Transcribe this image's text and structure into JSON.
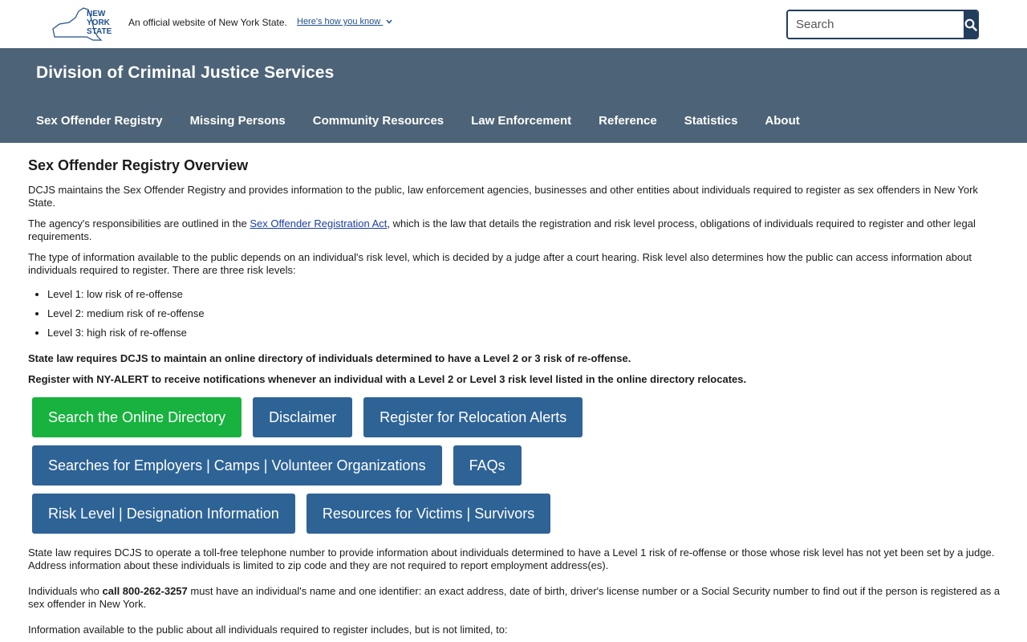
{
  "topbar": {
    "logo_text": [
      "NEW",
      "YORK",
      "STATE"
    ],
    "official_text": "An official website of New York State.",
    "how_know": "Here's how you know",
    "search_placeholder": "Search"
  },
  "header": {
    "agency_title": "Division of Criminal Justice Services",
    "nav": [
      {
        "label": "Sex Offender Registry"
      },
      {
        "label": "Missing Persons"
      },
      {
        "label": "Community Resources"
      },
      {
        "label": "Law Enforcement"
      },
      {
        "label": "Reference"
      },
      {
        "label": "Statistics"
      },
      {
        "label": "About"
      }
    ]
  },
  "main": {
    "title": "Sex Offender Registry Overview",
    "p1": "DCJS maintains the Sex Offender Registry and provides information to the public, law enforcement agencies, businesses and other entities about individuals required to register as sex offenders in New York State.",
    "p2_pre": "The agency's responsibilities are outlined in the ",
    "p2_link": "Sex Offender Registration Act",
    "p2_post": ", which is the law that details the registration and risk level process, obligations of individuals required to register and other legal requirements.",
    "p3": "The type of information available to the public depends on an individual's risk level, which is decided by a judge after a court hearing. Risk level also determines how the public can access information about individuals required to register. There are three risk levels:",
    "risk_levels": [
      "Level 1: low risk of re-offense",
      "Level 2: medium risk of re-offense",
      "Level 3: high risk of re-offense"
    ],
    "bold1": "State law requires DCJS to maintain an online directory of individuals determined to have a Level 2 or 3 risk of re-offense.",
    "bold2": "Register with NY-ALERT to receive notifications whenever an individual with a Level 2 or Level 3 risk level listed in the online directory relocates.",
    "buttons": {
      "search_directory": "Search the Online Directory",
      "disclaimer": "Disclaimer",
      "relocation_alerts": "Register for Relocation Alerts",
      "employers": "Searches for Employers | Camps | Volunteer Organizations",
      "faqs": "FAQs",
      "risk_level": "Risk Level | Designation Information",
      "victims": "Resources for Victims | Survivors"
    },
    "p4": "State law requires DCJS to operate a toll-free telephone number to provide information about individuals determined to have a Level 1 risk of re-offense or those whose risk level has not yet been set by a judge. Address information about these individuals is limited to zip code and they are not required to report employment address(es).",
    "p5_pre": "Individuals who ",
    "p5_call": "call 800-262-3257",
    "p5_post": " must have an individual's name and one identifier: an exact address, date of birth, driver's license number or a Social Security number to find out if the person is registered as a sex offender in New York.",
    "p6": "Information available to the public about all individuals required to register includes, but is not limited, to:"
  },
  "colors": {
    "header_bg": "#4d6377",
    "button_blue": "#2e6396",
    "button_green": "#17b33e",
    "search_btn": "#233d5d",
    "link": "#1a3ea6"
  }
}
